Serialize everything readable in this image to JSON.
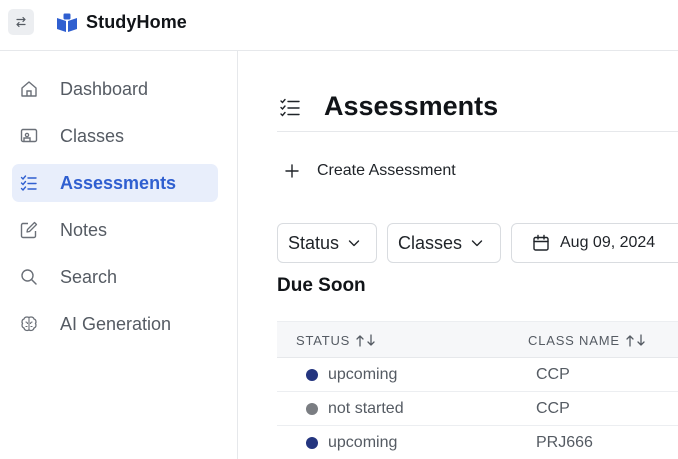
{
  "app": {
    "title": "StudyHome"
  },
  "colors": {
    "accent": "#2f5fd0",
    "active_bg": "#e8eefb",
    "upcoming": "#24357f",
    "not_started": "#7a7d82"
  },
  "sidebar": {
    "items": [
      {
        "label": "Dashboard",
        "icon": "home-icon",
        "active": false
      },
      {
        "label": "Classes",
        "icon": "classes-icon",
        "active": false
      },
      {
        "label": "Assessments",
        "icon": "checklist-icon",
        "active": true
      },
      {
        "label": "Notes",
        "icon": "edit-icon",
        "active": false
      },
      {
        "label": "Search",
        "icon": "search-icon",
        "active": false
      },
      {
        "label": "AI Generation",
        "icon": "brain-icon",
        "active": false
      }
    ]
  },
  "main": {
    "title": "Assessments",
    "create_label": "Create Assessment",
    "filters": {
      "status_label": "Status",
      "classes_label": "Classes",
      "date_label": "Aug 09, 2024"
    },
    "section_heading": "Due Soon",
    "table": {
      "headers": {
        "status": "STATUS",
        "class_name": "CLASS NAME"
      },
      "rows": [
        {
          "status": "upcoming",
          "class_name": "CCP"
        },
        {
          "status": "not started",
          "class_name": "CCP"
        },
        {
          "status": "upcoming",
          "class_name": "PRJ666"
        }
      ]
    }
  }
}
